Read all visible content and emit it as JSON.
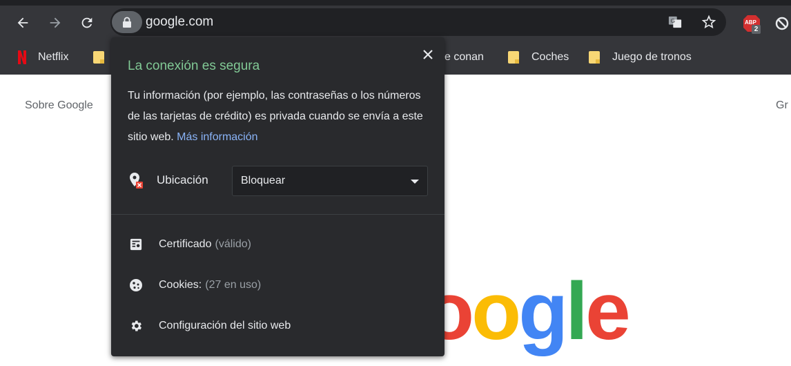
{
  "browser": {
    "url": "google.com",
    "abp_badge": "2",
    "abp_label": "ABP"
  },
  "bookmarks": [
    {
      "label": "Netflix",
      "icon": "netflix-icon"
    },
    {
      "label": "",
      "icon": "folder-icon"
    },
    {
      "label": "e conan",
      "icon": "folder-icon"
    },
    {
      "label": "Coches",
      "icon": "folder-icon"
    },
    {
      "label": "Juego de tronos",
      "icon": "folder-icon"
    }
  ],
  "page": {
    "left_link": "Sobre Google",
    "right_link": "Gr",
    "logo_letters": [
      "o",
      "o",
      "g",
      "l",
      "e"
    ]
  },
  "popup": {
    "title": "La conexión es segura",
    "description": "Tu información (por ejemplo, las contraseñas o los números de las tarjetas de crédito) es privada cuando se envía a este sitio web.",
    "more_link": "Más información",
    "permission": {
      "label": "Ubicación",
      "value": "Bloquear"
    },
    "certificate": {
      "label": "Certificado",
      "status": "(válido)"
    },
    "cookies": {
      "label": "Cookies:",
      "status": "(27 en uso)"
    },
    "site_settings": {
      "label": "Configuración del sitio web"
    }
  },
  "colors": {
    "toolbar": "#35363a",
    "popup_bg": "#292a2d",
    "secure_green": "#81c995",
    "link_blue": "#8ab4f8",
    "google_blue": "#4285f4",
    "google_red": "#ea4335",
    "google_yellow": "#fbbc05",
    "google_green": "#34a853"
  }
}
